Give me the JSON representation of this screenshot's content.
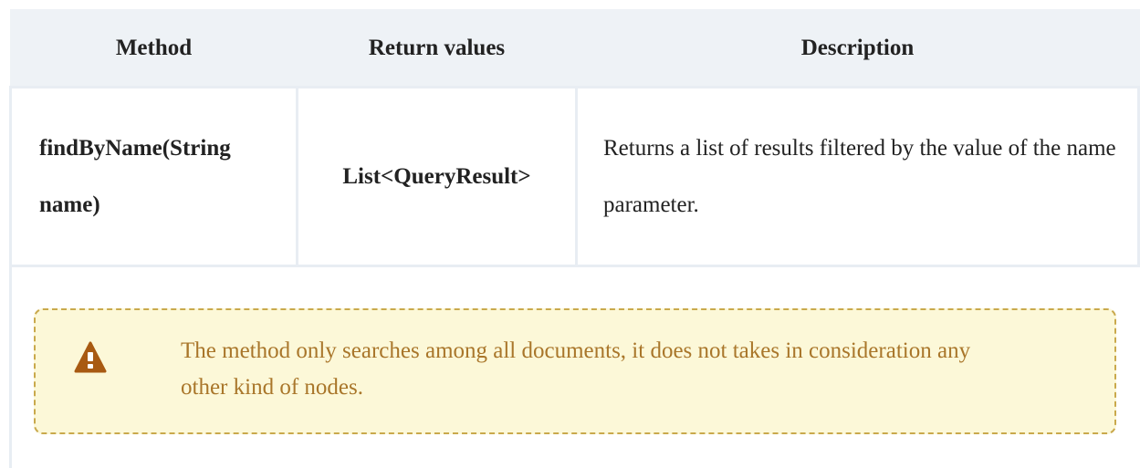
{
  "table": {
    "headers": [
      "Method",
      "Return values",
      "Description"
    ],
    "rows": [
      {
        "method": "findByName(String name)",
        "return_value": "List<QueryResult>",
        "description": "Returns a list of results filtered by the value of the name parameter."
      }
    ]
  },
  "warning": {
    "icon": "warning-triangle-icon",
    "text": "The method only searches among all documents, it does not takes in consideration any other kind of nodes.",
    "colors": {
      "background": "#fcf8d8",
      "border": "#c9a94c",
      "text": "#a9762a",
      "icon": "#a85a12"
    }
  }
}
